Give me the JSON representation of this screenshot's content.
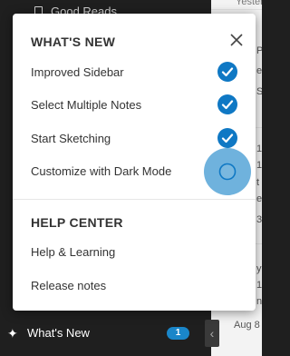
{
  "background": {
    "top_item": "Good Reads",
    "top_date": "Yester",
    "bottom_date": "Aug 8",
    "list_fragments": [
      "P",
      "e",
      "S",
      "1",
      "1",
      "t",
      "e",
      "3",
      "y",
      "1",
      "n",
      "1"
    ]
  },
  "whats_new_bar": {
    "label": "What's New",
    "count": "1"
  },
  "popup": {
    "whats_new_title": "WHAT'S NEW",
    "features": [
      {
        "label": "Improved Sidebar",
        "state": "done"
      },
      {
        "label": "Select Multiple Notes",
        "state": "done"
      },
      {
        "label": "Start Sketching",
        "state": "done"
      },
      {
        "label": "Customize with Dark Mode",
        "state": "pending"
      }
    ],
    "help_title": "HELP CENTER",
    "help_links": [
      "Help & Learning",
      "Release notes"
    ]
  },
  "colors": {
    "accent": "#0f78c4",
    "halo": "#6fb2dd",
    "badge": "#1a86c9"
  }
}
